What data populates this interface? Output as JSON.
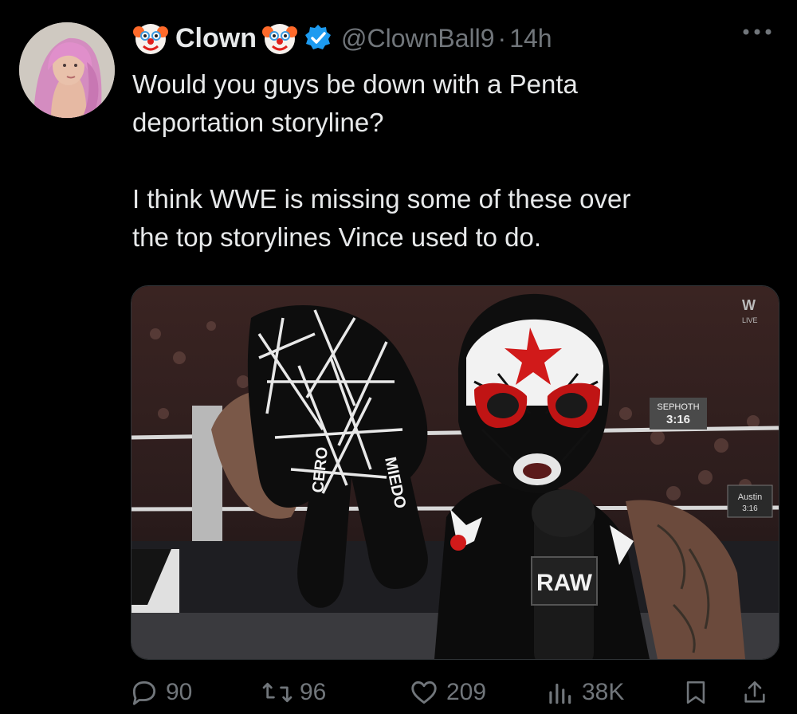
{
  "tweet": {
    "author_name": "Clown",
    "name_emoji_left": "clown-face-emoji",
    "name_emoji_right": "clown-face-emoji",
    "verified": true,
    "handle": "@ClownBall9",
    "separator": "·",
    "time": "14h",
    "text_lines": [
      "Would you guys be down with a Penta",
      "deportation storyline?",
      "",
      "I think WWE is missing some of these over",
      "the top storylines Vince used to do."
    ]
  },
  "media": {
    "overlay": {
      "network_logo": "W",
      "live_label": "LIVE",
      "banner_top": "SEPHOTH",
      "banner_bottom": "3:16",
      "glove_fingers": [
        "CERO",
        "MIEDO"
      ],
      "mic_flag": "RAW",
      "fan_sign_top": "Austin",
      "fan_sign_bottom": "3:16"
    }
  },
  "actions": {
    "replies": "90",
    "reposts": "96",
    "likes": "209",
    "views": "38K"
  },
  "colors": {
    "background": "#000000",
    "text": "#e7e9ea",
    "muted": "#71767b",
    "verified": "#1d9bf0"
  }
}
